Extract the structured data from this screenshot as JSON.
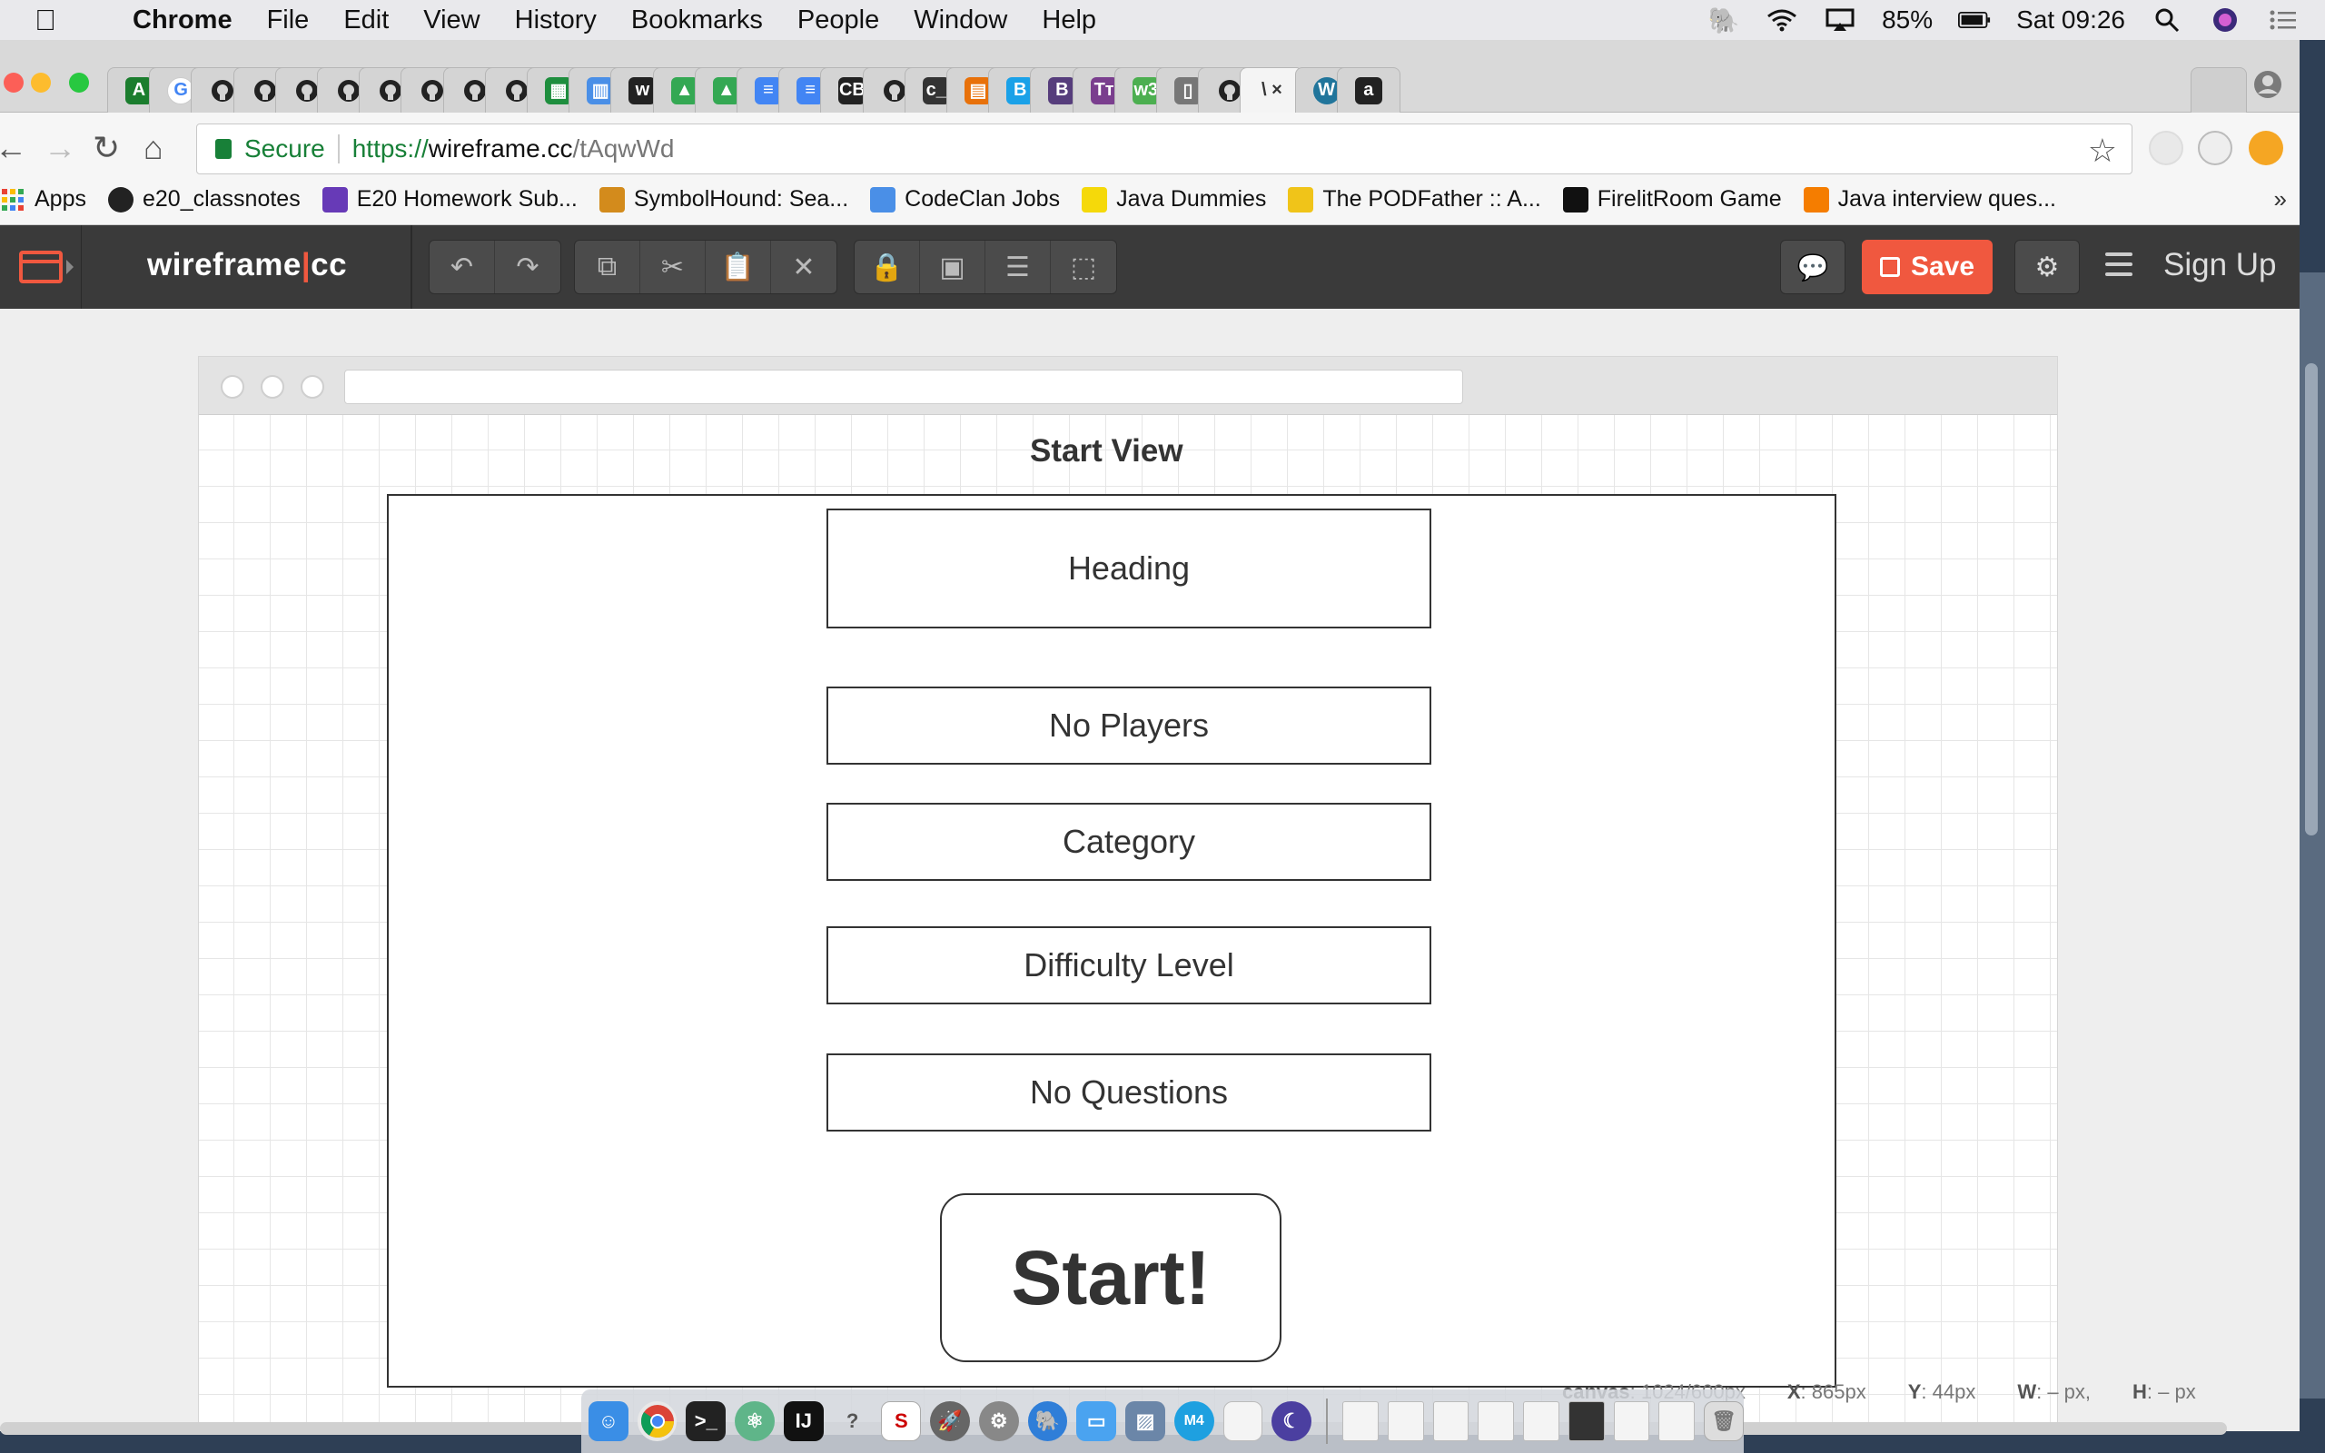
{
  "menubar": {
    "app": "Chrome",
    "items": [
      "File",
      "Edit",
      "View",
      "History",
      "Bookmarks",
      "People",
      "Window",
      "Help"
    ],
    "battery": "85%",
    "clock": "Sat 09:26"
  },
  "browser": {
    "tabs": [
      {
        "icon": "codeclan-icon",
        "color": "#1b7d2e",
        "glyph": "A"
      },
      {
        "icon": "google-icon",
        "color": "#ffffff",
        "glyph": "G"
      },
      {
        "icon": "github-icon",
        "color": "#222222",
        "glyph": ""
      },
      {
        "icon": "github-icon",
        "color": "#222222",
        "glyph": ""
      },
      {
        "icon": "github-icon",
        "color": "#222222",
        "glyph": ""
      },
      {
        "icon": "github-icon",
        "color": "#222222",
        "glyph": ""
      },
      {
        "icon": "github-icon",
        "color": "#222222",
        "glyph": ""
      },
      {
        "icon": "github-icon",
        "color": "#222222",
        "glyph": ""
      },
      {
        "icon": "github-icon",
        "color": "#222222",
        "glyph": ""
      },
      {
        "icon": "github-icon",
        "color": "#222222",
        "glyph": ""
      },
      {
        "icon": "sheets-icon",
        "color": "#1e8e3e",
        "glyph": "▦"
      },
      {
        "icon": "layout-icon",
        "color": "#4a8fe7",
        "glyph": "▥"
      },
      {
        "icon": "w-icon",
        "color": "#222222",
        "glyph": "w"
      },
      {
        "icon": "drive-icon",
        "color": "#34a853",
        "glyph": "▲"
      },
      {
        "icon": "drive-icon",
        "color": "#34a853",
        "glyph": "▲"
      },
      {
        "icon": "docs-icon",
        "color": "#4285f4",
        "glyph": "≡"
      },
      {
        "icon": "docs-icon",
        "color": "#4285f4",
        "glyph": "≡"
      },
      {
        "icon": "cb-icon",
        "color": "#222222",
        "glyph": "CB"
      },
      {
        "icon": "github-icon",
        "color": "#222222",
        "glyph": ""
      },
      {
        "icon": "terminal-icon",
        "color": "#333333",
        "glyph": "c_"
      },
      {
        "icon": "slides-icon",
        "color": "#e8710a",
        "glyph": "▤"
      },
      {
        "icon": "b-icon",
        "color": "#1aa1e8",
        "glyph": "B"
      },
      {
        "icon": "bootstrap-icon",
        "color": "#563d7c",
        "glyph": "B"
      },
      {
        "icon": "tt-icon",
        "color": "#7a3e8e",
        "glyph": "Tт"
      },
      {
        "icon": "w3-icon",
        "color": "#4caf50",
        "glyph": "w3"
      },
      {
        "icon": "file-icon",
        "color": "#777777",
        "glyph": "▯"
      },
      {
        "icon": "github-icon",
        "color": "#222222",
        "glyph": ""
      },
      {
        "icon": "wireframe-icon",
        "color": "#333333",
        "glyph": "\\ ×",
        "active": true
      },
      {
        "icon": "wordpress-icon",
        "color": "#21759b",
        "glyph": "W"
      },
      {
        "icon": "amazon-icon",
        "color": "#222222",
        "glyph": "a"
      }
    ],
    "secure_label": "Secure",
    "url_scheme": "https://",
    "url_host": "wireframe.cc",
    "url_path": "/tAqwWd",
    "bookmarks": [
      {
        "label": "Apps",
        "icon": "apps-grid-icon",
        "color": "#e94235"
      },
      {
        "label": "e20_classnotes",
        "icon": "github-icon",
        "color": "#222222"
      },
      {
        "label": "E20 Homework Sub...",
        "icon": "form-icon",
        "color": "#673ab7"
      },
      {
        "label": "SymbolHound: Sea...",
        "icon": "symbolhound-icon",
        "color": "#d38b1c"
      },
      {
        "label": "CodeClan Jobs",
        "icon": "layout-icon",
        "color": "#4a8fe7"
      },
      {
        "label": "Java Dummies",
        "icon": "dummies-icon",
        "color": "#f5d90a"
      },
      {
        "label": "The PODFather :: A...",
        "icon": "podfather-icon",
        "color": "#f0c419"
      },
      {
        "label": "FirelitRoom Game",
        "icon": "adr-icon",
        "color": "#111111"
      },
      {
        "label": "Java interview ques...",
        "icon": "blogger-icon",
        "color": "#f57d00"
      }
    ],
    "bookmarks_more": "»"
  },
  "app": {
    "logo_left": "wireframe",
    "logo_sep": "|",
    "logo_right": "cc",
    "save_label": "Save",
    "signup_label": "Sign Up",
    "accent": "#f0583f"
  },
  "canvas": {
    "view_title": "Start View",
    "fields": [
      "Heading",
      "No Players",
      "Category",
      "Difficulty Level",
      "No Questions"
    ],
    "start_label": "Start!"
  },
  "status": {
    "canvas_label": "canvas",
    "canvas_value": ": 1024/600px",
    "x_label": "X",
    "x_value": ": 865px",
    "y_label": "Y",
    "y_value": ": 44px",
    "w_label": "W",
    "w_value": ": – px,",
    "h_label": "H",
    "h_value": ": – px"
  }
}
